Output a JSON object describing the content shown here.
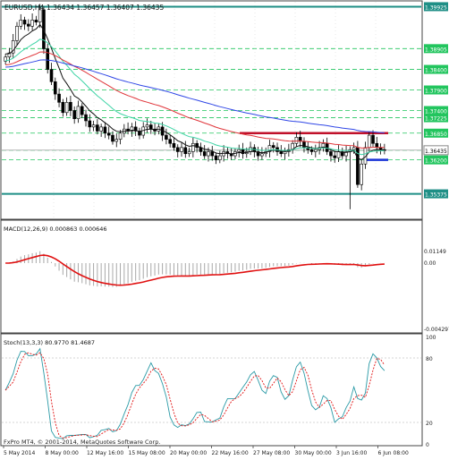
{
  "header": {
    "symbol": "EURUSD,H4",
    "ohlc": "1.36434 1.36457 1.36407 1.36435"
  },
  "colors": {
    "background": "#ffffff",
    "grid_green": "#22c55e",
    "level_teal": "#1f8f86",
    "resistance_red": "#c0102a",
    "support_blue": "#1733d6",
    "ma_black": "#111111",
    "ma_red": "#e0353a",
    "ma_green": "#3ed4a6",
    "ma_blue": "#3047e6",
    "macd_hist": "#a8a8a8",
    "macd_signal": "#e01010",
    "stoch_main": "#2a9aa6",
    "stoch_signal": "#e01010",
    "axis_text": "#222222"
  },
  "price_axis": {
    "labels": [
      "1.39925",
      "1.38905",
      "1.38400",
      "1.37900",
      "1.37400",
      "1.37225",
      "1.36850",
      "1.36435",
      "1.36200",
      "1.35375"
    ],
    "current": "1.36435",
    "resistance_label": "1.36850",
    "support_label": "1.36200",
    "bottom_label": "1.35375",
    "top_label": "1.39925"
  },
  "macd": {
    "title": "MACD(12,26,9) 0.000863 0.000646",
    "axis_labels": [
      "0.01149",
      "0.00",
      "-0.004297"
    ]
  },
  "stoch": {
    "title": "Stoch(13,3,3) 80.9770 81.4687",
    "axis_labels": [
      "100",
      "80",
      "20",
      "0"
    ]
  },
  "x_axis": {
    "labels": [
      "5 May 2014",
      "8 May 00:00",
      "12 May 16:00",
      "15 May 08:00",
      "20 May 00:00",
      "22 May 16:00",
      "27 May 08:00",
      "30 May 00:00",
      "3 Jun 16:00",
      "6 Jun 08:00"
    ]
  },
  "footer": {
    "copyright": "FxPro MT4, © 2001-2014, MetaQuotes Software Corp."
  },
  "chart_data": {
    "type": "candlestick",
    "title": "EURUSD,H4",
    "ylim": [
      1.348,
      1.4
    ],
    "resistance": 1.3685,
    "support": 1.362,
    "close_price": 1.36435,
    "close_series": [
      1.387,
      1.388,
      1.391,
      1.3945,
      1.396,
      1.395,
      1.3945,
      1.396,
      1.3955,
      1.3985,
      1.389,
      1.384,
      1.381,
      1.378,
      1.376,
      1.3735,
      1.376,
      1.374,
      1.372,
      1.375,
      1.373,
      1.3715,
      1.37,
      1.3705,
      1.369,
      1.37,
      1.3685,
      1.368,
      1.3665,
      1.367,
      1.3685,
      1.3695,
      1.369,
      1.37,
      1.369,
      1.368,
      1.37,
      1.3705,
      1.3695,
      1.369,
      1.37,
      1.368,
      1.367,
      1.366,
      1.365,
      1.364,
      1.365,
      1.3635,
      1.364,
      1.366,
      1.365,
      1.364,
      1.363,
      1.364,
      1.363,
      1.362,
      1.363,
      1.364,
      1.3635,
      1.363,
      1.364,
      1.3645,
      1.3635,
      1.364,
      1.365,
      1.364,
      1.363,
      1.3635,
      1.364,
      1.3655,
      1.365,
      1.364,
      1.3635,
      1.364,
      1.3645,
      1.366,
      1.3675,
      1.3665,
      1.365,
      1.3645,
      1.364,
      1.3645,
      1.365,
      1.366,
      1.364,
      1.363,
      1.3625,
      1.364,
      1.363,
      1.364,
      1.3645,
      1.365,
      1.356,
      1.361,
      1.365,
      1.368,
      1.366,
      1.365,
      1.3645,
      1.36435
    ]
  }
}
